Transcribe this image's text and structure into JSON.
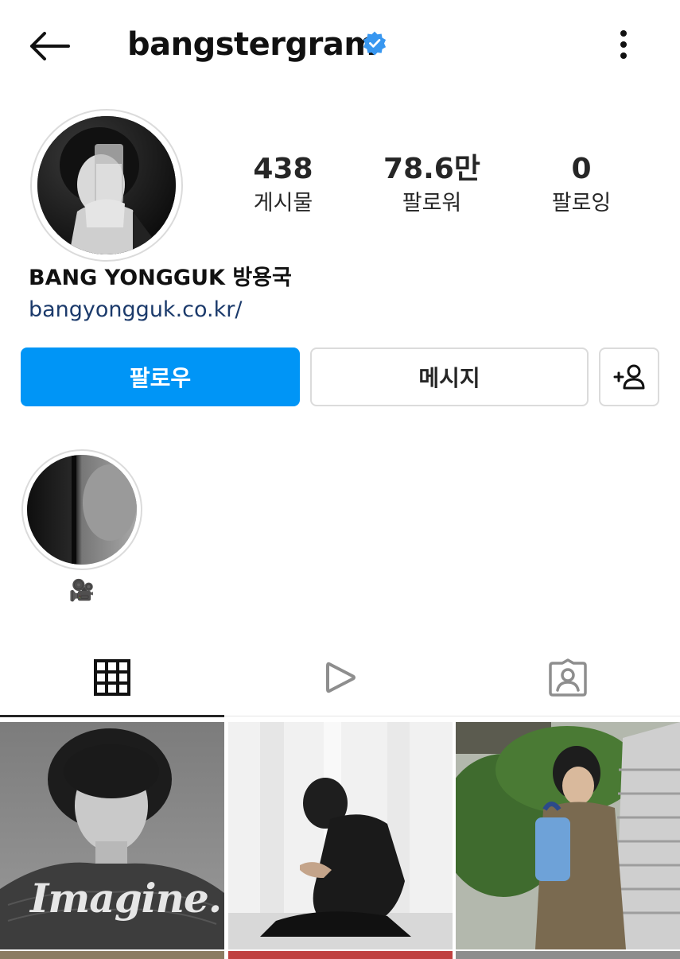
{
  "header": {
    "username": "bangstergram",
    "verified": true,
    "icons": {
      "back": "arrow-left-icon",
      "verified": "verified-badge-icon",
      "more": "more-vertical-icon"
    }
  },
  "profile": {
    "full_name": "BANG YONGGUK 방용국",
    "link": "bangyongguk.co.kr/",
    "stats": [
      {
        "value": "438",
        "label": "게시물"
      },
      {
        "value": "78.6만",
        "label": "팔로워"
      },
      {
        "value": "0",
        "label": "팔로잉"
      }
    ]
  },
  "actions": {
    "follow_label": "팔로우",
    "message_label": "메시지",
    "suggest_icon": "add-person-icon"
  },
  "highlights": [
    {
      "label": "🎥"
    }
  ],
  "tabs": [
    {
      "icon": "grid-icon",
      "active": true
    },
    {
      "icon": "reels-play-icon",
      "active": false
    },
    {
      "icon": "tagged-person-icon",
      "active": false
    }
  ],
  "posts": [
    {
      "caption_text": "Imagine."
    },
    {
      "caption_text": ""
    },
    {
      "caption_text": ""
    }
  ],
  "colors": {
    "accent": "#0095f6",
    "link": "#1b3a6b",
    "verified": "#3897f0",
    "text": "#262626",
    "border": "#dbdbdb"
  }
}
